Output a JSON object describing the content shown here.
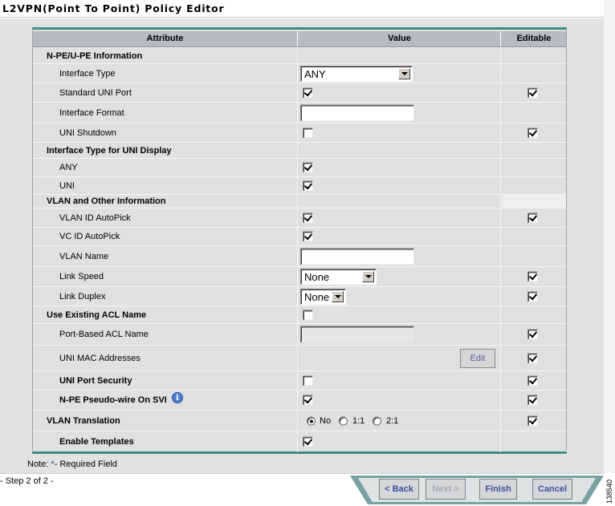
{
  "title": "L2VPN(Point To Point) Policy Editor",
  "table": {
    "headers": {
      "attribute": "Attribute",
      "value": "Value",
      "editable": "Editable"
    },
    "rows": {
      "npe_section": {
        "label": "N-PE/U-PE Information"
      },
      "interface_type": {
        "label": "Interface Type",
        "select_value": "ANY",
        "editable": false
      },
      "standard_uni_port": {
        "label": "Standard UNI Port",
        "checked": true,
        "editable": true
      },
      "interface_format": {
        "label": "Interface Format",
        "value": "",
        "editable": false
      },
      "uni_shutdown": {
        "label": "UNI Shutdown",
        "checked": false,
        "editable": true
      },
      "uni_display_section": {
        "label": "Interface Type for UNI Display"
      },
      "any": {
        "label": "ANY",
        "checked": true
      },
      "uni": {
        "label": "UNI",
        "checked": true
      },
      "vlan_section": {
        "label": "VLAN and Other Information"
      },
      "vlan_id_autopick": {
        "label": "VLAN ID AutoPick",
        "checked": true,
        "editable": true
      },
      "vc_id_autopick": {
        "label": "VC ID AutoPick",
        "checked": true
      },
      "vlan_name": {
        "label": "VLAN Name",
        "value": ""
      },
      "link_speed": {
        "label": "Link Speed",
        "select_value": "None",
        "editable": true
      },
      "link_duplex": {
        "label": "Link Duplex",
        "select_value": "None",
        "editable": true
      },
      "use_existing_acl": {
        "label": "Use Existing ACL Name",
        "checked": false
      },
      "port_based_acl": {
        "label": "Port-Based ACL Name",
        "value": "",
        "editable": true
      },
      "uni_mac": {
        "label": "UNI MAC Addresses",
        "button": "Edit",
        "editable": true
      },
      "uni_port_security": {
        "label": "UNI Port Security",
        "checked": false,
        "editable": true
      },
      "npe_pseudowire": {
        "label": "N-PE Pseudo-wire On SVI",
        "info_icon": "info-icon",
        "checked": true,
        "editable": true
      },
      "vlan_translation": {
        "label": "VLAN Translation",
        "options": [
          "No",
          "1:1",
          "2:1"
        ],
        "selected": "No",
        "editable": true
      },
      "enable_templates": {
        "label": "Enable Templates",
        "checked": true
      }
    }
  },
  "note": {
    "prefix": "Note: ",
    "marker": "*",
    "text": "- Required Field"
  },
  "step": "- Step 2 of 2 -",
  "buttons": {
    "back": "< Back",
    "next": "Next >",
    "finish": "Finish",
    "cancel": "Cancel"
  },
  "figure_number": "138540",
  "colors": {
    "accent": "#3f8d86",
    "button_text": "#3f4fa0",
    "panel": "#e0e0e0"
  }
}
